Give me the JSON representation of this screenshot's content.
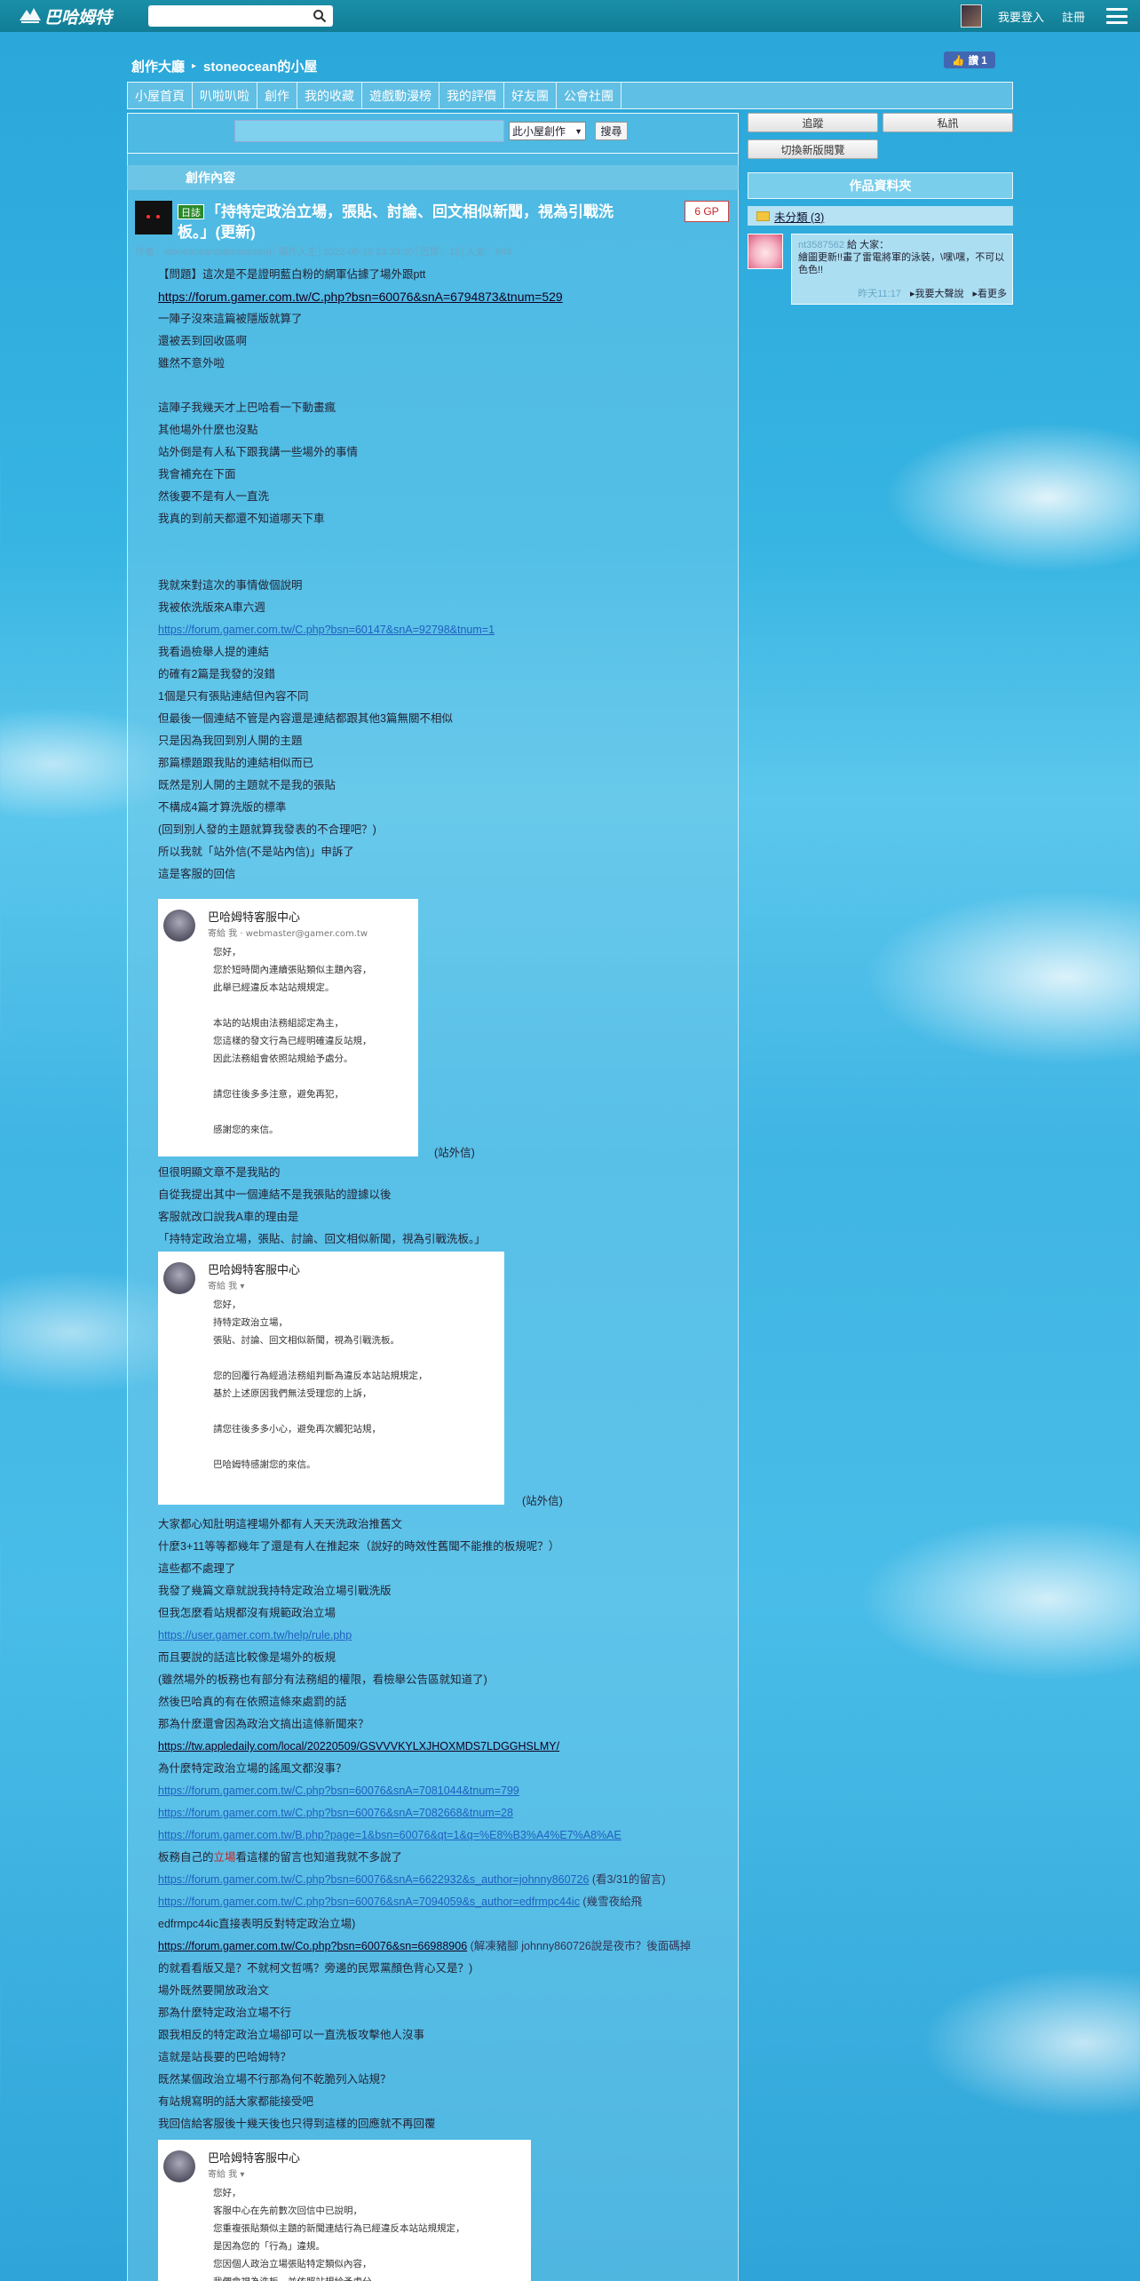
{
  "topbar": {
    "logo": "巴哈姆特",
    "login": "我要登入",
    "register": "註冊"
  },
  "header": {
    "hall": "創作大廳",
    "house": "stoneocean的小屋",
    "like_label": "讚 1"
  },
  "nav": [
    "小屋首頁",
    "叭啦叭啦",
    "創作",
    "我的收藏",
    "遊戲動漫榜",
    "我的評價",
    "好友團",
    "公會社團"
  ],
  "site_search": {
    "placeholder": "",
    "scope": "此小屋創作",
    "button": "搜尋"
  },
  "section_title": "創作內容",
  "article": {
    "tag": "日誌",
    "title": "「持特定政治立場，張貼、討論、回文相似新聞，視為引戰洗板。」(更新)",
    "gp": "6 GP",
    "meta": "作者：stoneocean(stoneocean)│場外人生│2022-05-18 23:33:00│巴幣：12│人氣：848"
  },
  "content": {
    "lines": [
      {
        "text": "【問題】這次是不是證明藍白粉的網軍佔據了場外跟ptt",
        "cls": ""
      },
      {
        "text": "https://forum.gamer.com.tw/C.php?bsn=60076&snA=6794873&tnum=529",
        "cls": "link-dark big"
      },
      {
        "text": "一陣子沒來這篇被隱版就算了",
        "cls": ""
      },
      {
        "text": "還被丟到回收區啊",
        "cls": ""
      },
      {
        "text": "雖然不意外啦",
        "cls": ""
      },
      {
        "text": "",
        "cls": ""
      },
      {
        "text": "這陣子我幾天才上巴哈看一下動畫瘋",
        "cls": ""
      },
      {
        "text": "其他場外什麼也沒點",
        "cls": ""
      },
      {
        "text": "站外倒是有人私下跟我講一些場外的事情",
        "cls": ""
      },
      {
        "text": "我會補充在下面",
        "cls": ""
      },
      {
        "text": "然後要不是有人一直洗",
        "cls": ""
      },
      {
        "text": "我真的到前天都還不知道哪天下車",
        "cls": ""
      },
      {
        "text": "",
        "cls": ""
      },
      {
        "text": "",
        "cls": ""
      },
      {
        "text": "我就來對這次的事情做個說明",
        "cls": ""
      },
      {
        "text": "我被依洗版來A車六週",
        "cls": ""
      },
      {
        "text": "https://forum.gamer.com.tw/C.php?bsn=60147&snA=92798&tnum=1",
        "cls": "link-blue"
      },
      {
        "text": "我看過檢舉人提的連結",
        "cls": ""
      },
      {
        "text": "的確有2篇是我發的沒錯",
        "cls": ""
      },
      {
        "text": "1個是只有張貼連結但內容不同",
        "cls": ""
      },
      {
        "text": "但最後一個連結不管是內容還是連結都跟其他3篇無關不相似",
        "cls": ""
      },
      {
        "text": "只是因為我回到別人開的主題",
        "cls": ""
      },
      {
        "text": "那篇標題跟我貼的連結相似而已",
        "cls": ""
      },
      {
        "text": "既然是別人開的主題就不是我的張貼",
        "cls": ""
      },
      {
        "text": "不構成4篇才算洗版的標準",
        "cls": ""
      },
      {
        "text": "(回到別人發的主題就算我發表的不合理吧？)",
        "cls": ""
      },
      {
        "text": "所以我就「站外信(不是站內信)」申訴了",
        "cls": ""
      },
      {
        "text": "這是客服的回信",
        "cls": ""
      }
    ],
    "mail1": {
      "sender": "巴哈姆特客服中心",
      "to": "寄給 我 ·  webmaster@gamer.com.tw",
      "body": "您好，\n您於短時間內連續張貼類似主題內容，\n此舉已經違反本站站規規定。\n\n本站的站規由法務組認定為主，\n您這樣的發文行為已經明確違反站規，\n因此法務組會依照站規給予處分。\n\n請您往後多多注意，避免再犯，\n\n感謝您的來信。",
      "caption": "(站外信)"
    },
    "lines2": [
      {
        "text": "但很明顯文章不是我貼的",
        "cls": ""
      },
      {
        "text": "自從我提出其中一個連結不是我張貼的證據以後",
        "cls": ""
      },
      {
        "text": "客服就改口說我A車的理由是",
        "cls": ""
      },
      {
        "text": "「持特定政治立場，張貼、討論、回文相似新聞，視為引戰洗板。」",
        "cls": ""
      }
    ],
    "mail2": {
      "sender": "巴哈姆特客服中心",
      "to": "寄給 我 ▾",
      "body": "您好，\n持特定政治立場，\n張貼、討論、回文相似新聞，視為引戰洗板。\n\n您的回覆行為經過法務組判斷為違反本站站規規定，\n基於上述原因我們無法受理您的上訴，\n\n請您往後多多小心，避免再次觸犯站規，\n\n巴哈姆特感謝您的來信。",
      "caption": "(站外信)"
    },
    "lines3": [
      {
        "text": "大家都心知肚明這裡場外都有人天天洗政治推舊文",
        "cls": ""
      },
      {
        "text": "什麼3+11等等都幾年了還是有人在推起來（說好的時效性舊聞不能推的板規呢？）",
        "cls": ""
      },
      {
        "text": "這些都不處理了",
        "cls": ""
      },
      {
        "text": "我發了幾篇文章就說我持特定政治立場引戰洗版",
        "cls": ""
      },
      {
        "text": "但我怎麼看站規都沒有規範政治立場",
        "cls": ""
      },
      {
        "text": "https://user.gamer.com.tw/help/rule.php",
        "cls": "link-blue"
      },
      {
        "text": "而且要說的話這比較像是場外的板規",
        "cls": ""
      },
      {
        "text": "(雖然場外的板務也有部分有法務組的權限，看檢舉公告區就知道了)",
        "cls": ""
      },
      {
        "text": "然後巴哈真的有在依照這條來處罰的話",
        "cls": ""
      },
      {
        "text": "那為什麼還會因為政治文搞出這條新聞來？",
        "cls": ""
      },
      {
        "text": "https://tw.appledaily.com/local/20220509/GSVVVKYLXJHOXMDS7LDGGHSLMY/",
        "cls": "link-dark"
      },
      {
        "text": "為什麼特定政治立場的謠風文都沒事？",
        "cls": ""
      },
      {
        "text": "https://forum.gamer.com.tw/C.php?bsn=60076&snA=7081044&tnum=799",
        "cls": "link-blue"
      },
      {
        "text": "https://forum.gamer.com.tw/C.php?bsn=60076&snA=7082668&tnum=28",
        "cls": "link-blue"
      },
      {
        "text": "https://forum.gamer.com.tw/B.php?page=1&bsn=60076&qt=1&q=%E8%B3%A4%E7%A8%AE",
        "cls": "link-blue"
      }
    ],
    "line_red_pre": "板務自己的",
    "line_red_word": "立場",
    "line_red_post": "看這樣的留言也知道我就不多說了",
    "link_a": "https://forum.gamer.com.tw/C.php?bsn=60076&snA=6622932&s_author=johnny860726",
    "link_a_note": " (看3/31的留言)",
    "link_b": "https://forum.gamer.com.tw/C.php?bsn=60076&snA=7094059&s_author=edfrmpc44ic",
    "link_b_note": " (幾雪夜給飛",
    "line_b2": "edfrmpc44ic直接表明反對特定政治立場)",
    "link_c": "https://forum.gamer.com.tw/Co.php?bsn=60076&sn=66988906",
    "link_c_note": " (解凍豬腳 johnny860726說是夜市？後面碼掉",
    "line_c2": "的就看看版又是？不就柯文哲嗎？旁邊的民眾黨顏色背心又是？)",
    "lines4": [
      {
        "text": "場外既然要開放政治文",
        "cls": ""
      },
      {
        "text": "那為什麼特定政治立場不行",
        "cls": ""
      },
      {
        "text": "跟我相反的特定政治立場卻可以一直洗板攻擊他人沒事",
        "cls": ""
      },
      {
        "text": "這就是站長要的巴哈姆特？",
        "cls": ""
      },
      {
        "text": "既然某個政治立場不行那為何不乾脆列入站規？",
        "cls": ""
      },
      {
        "text": "有站規寫明的話大家都能接受吧",
        "cls": ""
      },
      {
        "text": "我回信給客服後十幾天後也只得到這樣的回應就不再回覆",
        "cls": ""
      }
    ],
    "mail3": {
      "sender": "巴哈姆特客服中心",
      "to": "寄給 我 ▾",
      "body": "您好，\n客服中心在先前數次回信中已說明，\n您重複張貼類似主題的新聞連結行為已經違反本站站規規定，\n是因為您的「行為」違規。\n您因個人政治立場張貼特定類似內容，\n我們會視為洗板，並依照站規給予處分。\n\n客服已多次回覆說明，後續不再予以回覆。"
    }
  },
  "sidebar": {
    "follow": "追蹤",
    "message": "私訊",
    "switch_view": "切換新版閱覽",
    "folder_title": "作品資料夾",
    "folder_item": "未分類 (3)",
    "comment_user": "nt3587562",
    "comment_text": " 給 大家：",
    "comment_body": "繪圖更新!!畫了雷電將軍的泳裝，\\嘿\\嘿，不可以色色!!",
    "comment_time": "昨天11:17",
    "comment_reply": "我要大聲說",
    "comment_more": "看更多"
  }
}
